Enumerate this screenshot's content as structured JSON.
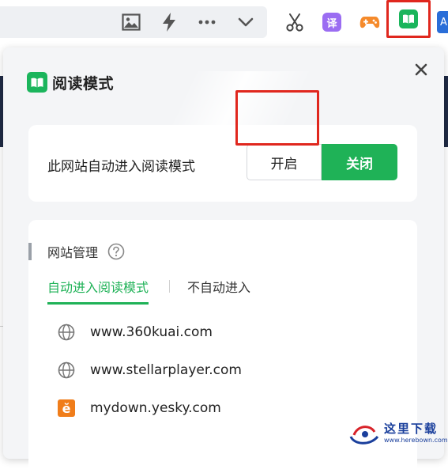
{
  "toolbar": {
    "icons": [
      "image-icon",
      "lightning-icon",
      "more-icon",
      "chevron-down-icon",
      "scissors-icon",
      "translate-icon",
      "game-controller-icon",
      "reader-mode-icon"
    ],
    "translate_label": "译",
    "edge_label": "A"
  },
  "popup": {
    "title": "阅读模式",
    "auto_label": "此网站自动进入阅读模式",
    "on_label": "开启",
    "off_label": "关闭",
    "section_title": "网站管理",
    "tabs": [
      {
        "label": "自动进入阅读模式",
        "active": true
      },
      {
        "label": "不自动进入",
        "active": false
      }
    ],
    "sites": [
      {
        "domain": "www.360kuai.com",
        "icon": "globe-icon"
      },
      {
        "domain": "www.stellarplayer.com",
        "icon": "globe-icon"
      },
      {
        "domain": "mydown.yesky.com",
        "icon": "yesky-icon",
        "icon_text": "ĕ"
      }
    ]
  },
  "watermark": {
    "text": "这里下载",
    "url": "www.herebown.com"
  },
  "colors": {
    "accent_green": "#1fb257",
    "highlight_red": "#e0271e",
    "popup_bg": "#f4f5f7"
  }
}
